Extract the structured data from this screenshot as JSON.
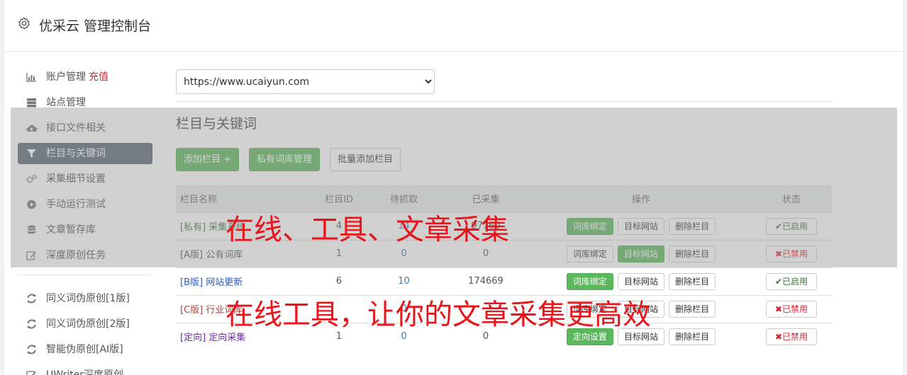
{
  "app": {
    "title": "优采云 管理控制台"
  },
  "sidebar": {
    "items": [
      {
        "label": "账户管理",
        "extra": "充值",
        "icon": "bar-chart-icon"
      },
      {
        "label": "站点管理",
        "icon": "server-icon"
      },
      {
        "label": "接口文件相关",
        "icon": "cloud-upload-icon"
      },
      {
        "label": "栏目与关键词",
        "icon": "filter-icon",
        "active": true
      },
      {
        "label": "采集细节设置",
        "icon": "gears-icon"
      },
      {
        "label": "手动运行测试",
        "icon": "play-circle-icon"
      },
      {
        "label": "文章暂存库",
        "icon": "database-icon"
      },
      {
        "label": "深度原创任务",
        "icon": "edit-icon"
      }
    ],
    "items2": [
      {
        "label": "同义词伪原创[1版]",
        "icon": "refresh-icon"
      },
      {
        "label": "同义词伪原创[2版]",
        "icon": "refresh-icon"
      },
      {
        "label": "智能伪原创[AI版]",
        "icon": "refresh-icon"
      },
      {
        "label": "UWriter深度原创",
        "icon": "edit-icon"
      }
    ]
  },
  "main": {
    "site_select": {
      "value": "https://www.ucaiyun.com"
    },
    "section_title": "栏目与关键词",
    "buttons": {
      "add": "添加栏目 +",
      "private": "私有词库管理",
      "batch": "批量添加栏目"
    },
    "table": {
      "headers": [
        "栏目名称",
        "栏目ID",
        "待抓取",
        "已采集",
        "操作",
        "状态"
      ],
      "rows": [
        {
          "tag": "[私有]",
          "name": "采集系统",
          "id": "4",
          "pending": "14",
          "collected": "97160",
          "btn1": "词库绑定",
          "btn2": "目标网站",
          "btn3": "删除栏目",
          "status": "已启用"
        },
        {
          "tag": "[A版]",
          "name": "公有词库",
          "id": "1",
          "pending": "0",
          "collected": "0",
          "btn1": "词库绑定",
          "btn2": "目标网站",
          "btn3": "删除栏目",
          "status": "已禁用"
        },
        {
          "tag": "[B版]",
          "name": "网站更新",
          "id": "6",
          "pending": "10",
          "collected": "174669",
          "btn1": "词库绑定",
          "btn2": "目标网站",
          "btn3": "删除栏目",
          "status": "已启用"
        },
        {
          "tag": "[C版]",
          "name": "行业词库",
          "id": "",
          "pending": "0",
          "collected": "",
          "btn1": "词库绑定",
          "btn2": "目标网站",
          "btn3": "删除栏目",
          "status": "已禁用"
        },
        {
          "tag": "[定向]",
          "name": "定向采集",
          "id": "1",
          "pending": "0",
          "collected": "0",
          "btn1": "定向设置",
          "btn2": "目标网站",
          "btn3": "删除栏目",
          "status": "已禁用"
        }
      ]
    }
  },
  "watermark": {
    "line1": "在线、工具、文章采集",
    "line2": "在线工具，让你的文章采集更高效"
  },
  "colors": {
    "accent_green": "#5cb85c",
    "active_nav": "#5a6776",
    "danger": "#d9242d",
    "watermark": "#e8141a"
  }
}
